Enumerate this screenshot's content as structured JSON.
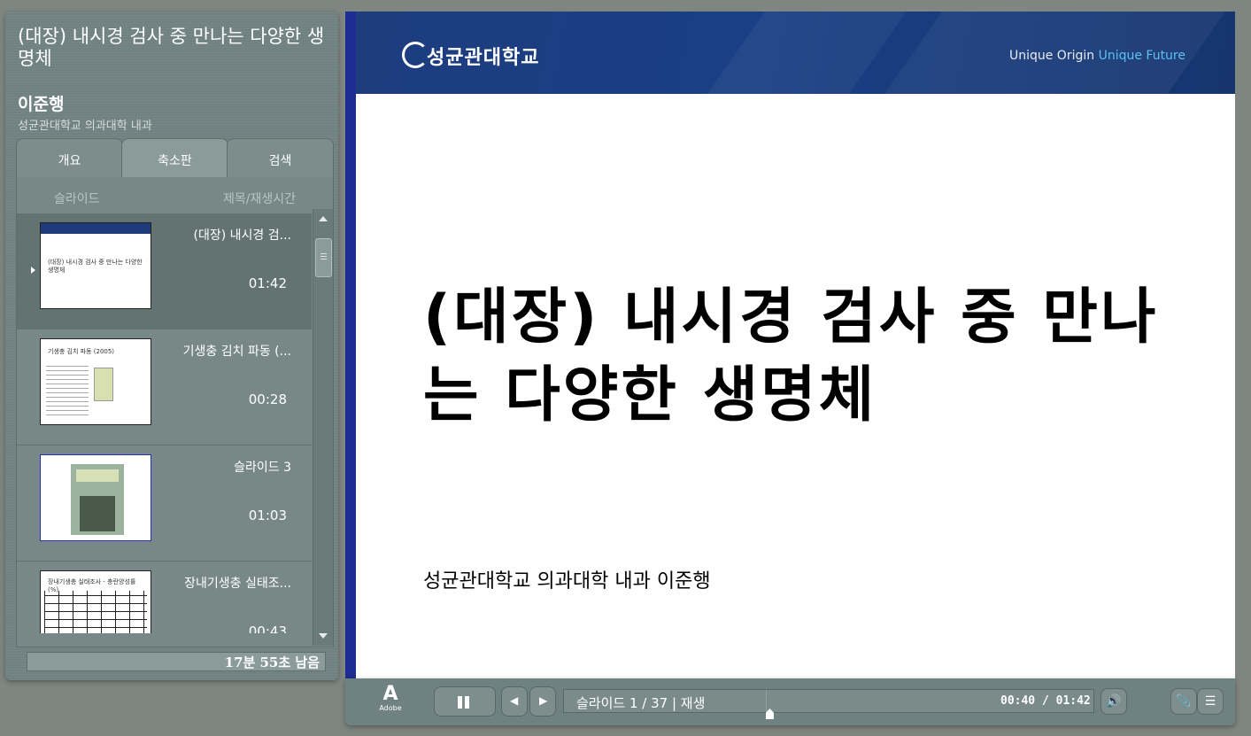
{
  "sidebar": {
    "title": "(대장) 내시경 검사 중 만나는 다양한 생명체",
    "presenter": "이준행",
    "organization": "성균관대학교 의과대학 내과",
    "tabs": [
      {
        "label": "개요"
      },
      {
        "label": "축소판"
      },
      {
        "label": "검색"
      }
    ],
    "list_headers": {
      "slide": "슬라이드",
      "title_time": "제목/재생시간"
    },
    "items": [
      {
        "title": "(대장) 내시경 검...",
        "time": "01:42",
        "thumb_text": "(대장) 내시경 검사 중 만나는 다양한 생명체"
      },
      {
        "title": "기생충 김치 파동 (...",
        "time": "00:28",
        "thumb_text": "기생충 김치 파동 (2005)"
      },
      {
        "title": "슬라이드 3",
        "time": "01:03",
        "thumb_text": ""
      },
      {
        "title": "장내기생충 실태조...",
        "time": "00:43",
        "thumb_text": "장내기생충 실태조사 - 충란양성률 (%)"
      }
    ],
    "remaining": "17분 55초 남음"
  },
  "slide": {
    "logo_text": "성균관대학교",
    "tagline_a": "Unique Origin ",
    "tagline_b": "Unique Future",
    "title": "(대장) 내시경 검사 중 만나는 다양한 생명체",
    "subtitle": "성균관대학교 의과대학 내과 이준행"
  },
  "controls": {
    "adobe_label": "Adobe",
    "status": "슬라이드 1 / 37 | 재생",
    "time": "00:40 / 01:42",
    "icons": [
      "pause-icon",
      "previous-icon",
      "next-icon",
      "volume-icon",
      "attachment-icon",
      "sidebar-toggle-icon"
    ]
  },
  "colors": {
    "accent_blue": "#1d2d91",
    "header_blue": "#1a3f85",
    "tagline_highlight": "#5dc0f0",
    "panel": "#6f8180"
  }
}
